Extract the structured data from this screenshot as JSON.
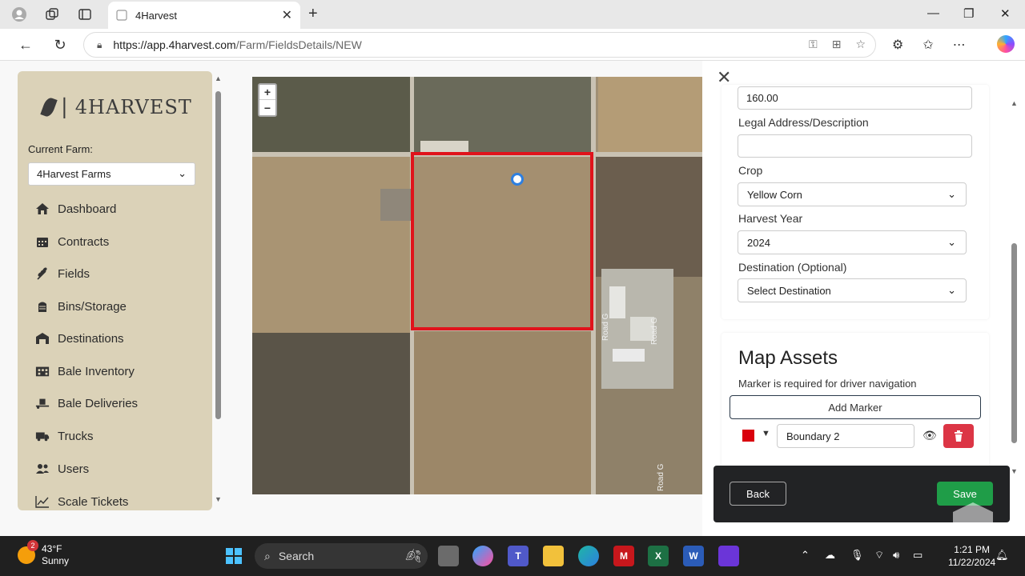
{
  "browser": {
    "tab_title": "4Harvest",
    "url_host": "https://app.4harvest.com",
    "url_path": "/Farm/FieldsDetails/NEW"
  },
  "sidebar": {
    "logo_text": "4HARVEST",
    "current_farm_label": "Current Farm:",
    "current_farm_value": "4Harvest Farms",
    "items": [
      {
        "label": "Dashboard",
        "icon": "home-icon"
      },
      {
        "label": "Contracts",
        "icon": "calendar-icon"
      },
      {
        "label": "Fields",
        "icon": "wheat-icon"
      },
      {
        "label": "Bins/Storage",
        "icon": "silo-icon"
      },
      {
        "label": "Destinations",
        "icon": "warehouse-icon"
      },
      {
        "label": "Bale Inventory",
        "icon": "building-icon"
      },
      {
        "label": "Bale Deliveries",
        "icon": "truck-loading-icon"
      },
      {
        "label": "Trucks",
        "icon": "truck-icon"
      },
      {
        "label": "Users",
        "icon": "users-icon"
      },
      {
        "label": "Scale Tickets",
        "icon": "chart-line-icon"
      }
    ]
  },
  "map": {
    "zoom_in": "+",
    "zoom_out": "−",
    "road_label_1": "Road G",
    "road_label_2": "Road G",
    "road_label_3": "Road G",
    "boundary_color": "#d9000d"
  },
  "form": {
    "acres_value": "160.00",
    "legal_label": "Legal Address/Description",
    "legal_value": "",
    "crop_label": "Crop",
    "crop_value": "Yellow Corn",
    "harvest_year_label": "Harvest Year",
    "harvest_year_value": "2024",
    "destination_label": "Destination (Optional)",
    "destination_value": "Select Destination"
  },
  "assets": {
    "title": "Map Assets",
    "subtitle": "Marker is required for driver navigation",
    "add_marker_label": "Add Marker",
    "boundary_name": "Boundary 2",
    "boundary_color": "#d9000d"
  },
  "footer": {
    "back_label": "Back",
    "save_label": "Save"
  },
  "taskbar": {
    "temp": "43°F",
    "condition": "Sunny",
    "notification_count": "2",
    "search_label": "Search",
    "time": "1:21 PM",
    "date": "11/22/2024"
  }
}
